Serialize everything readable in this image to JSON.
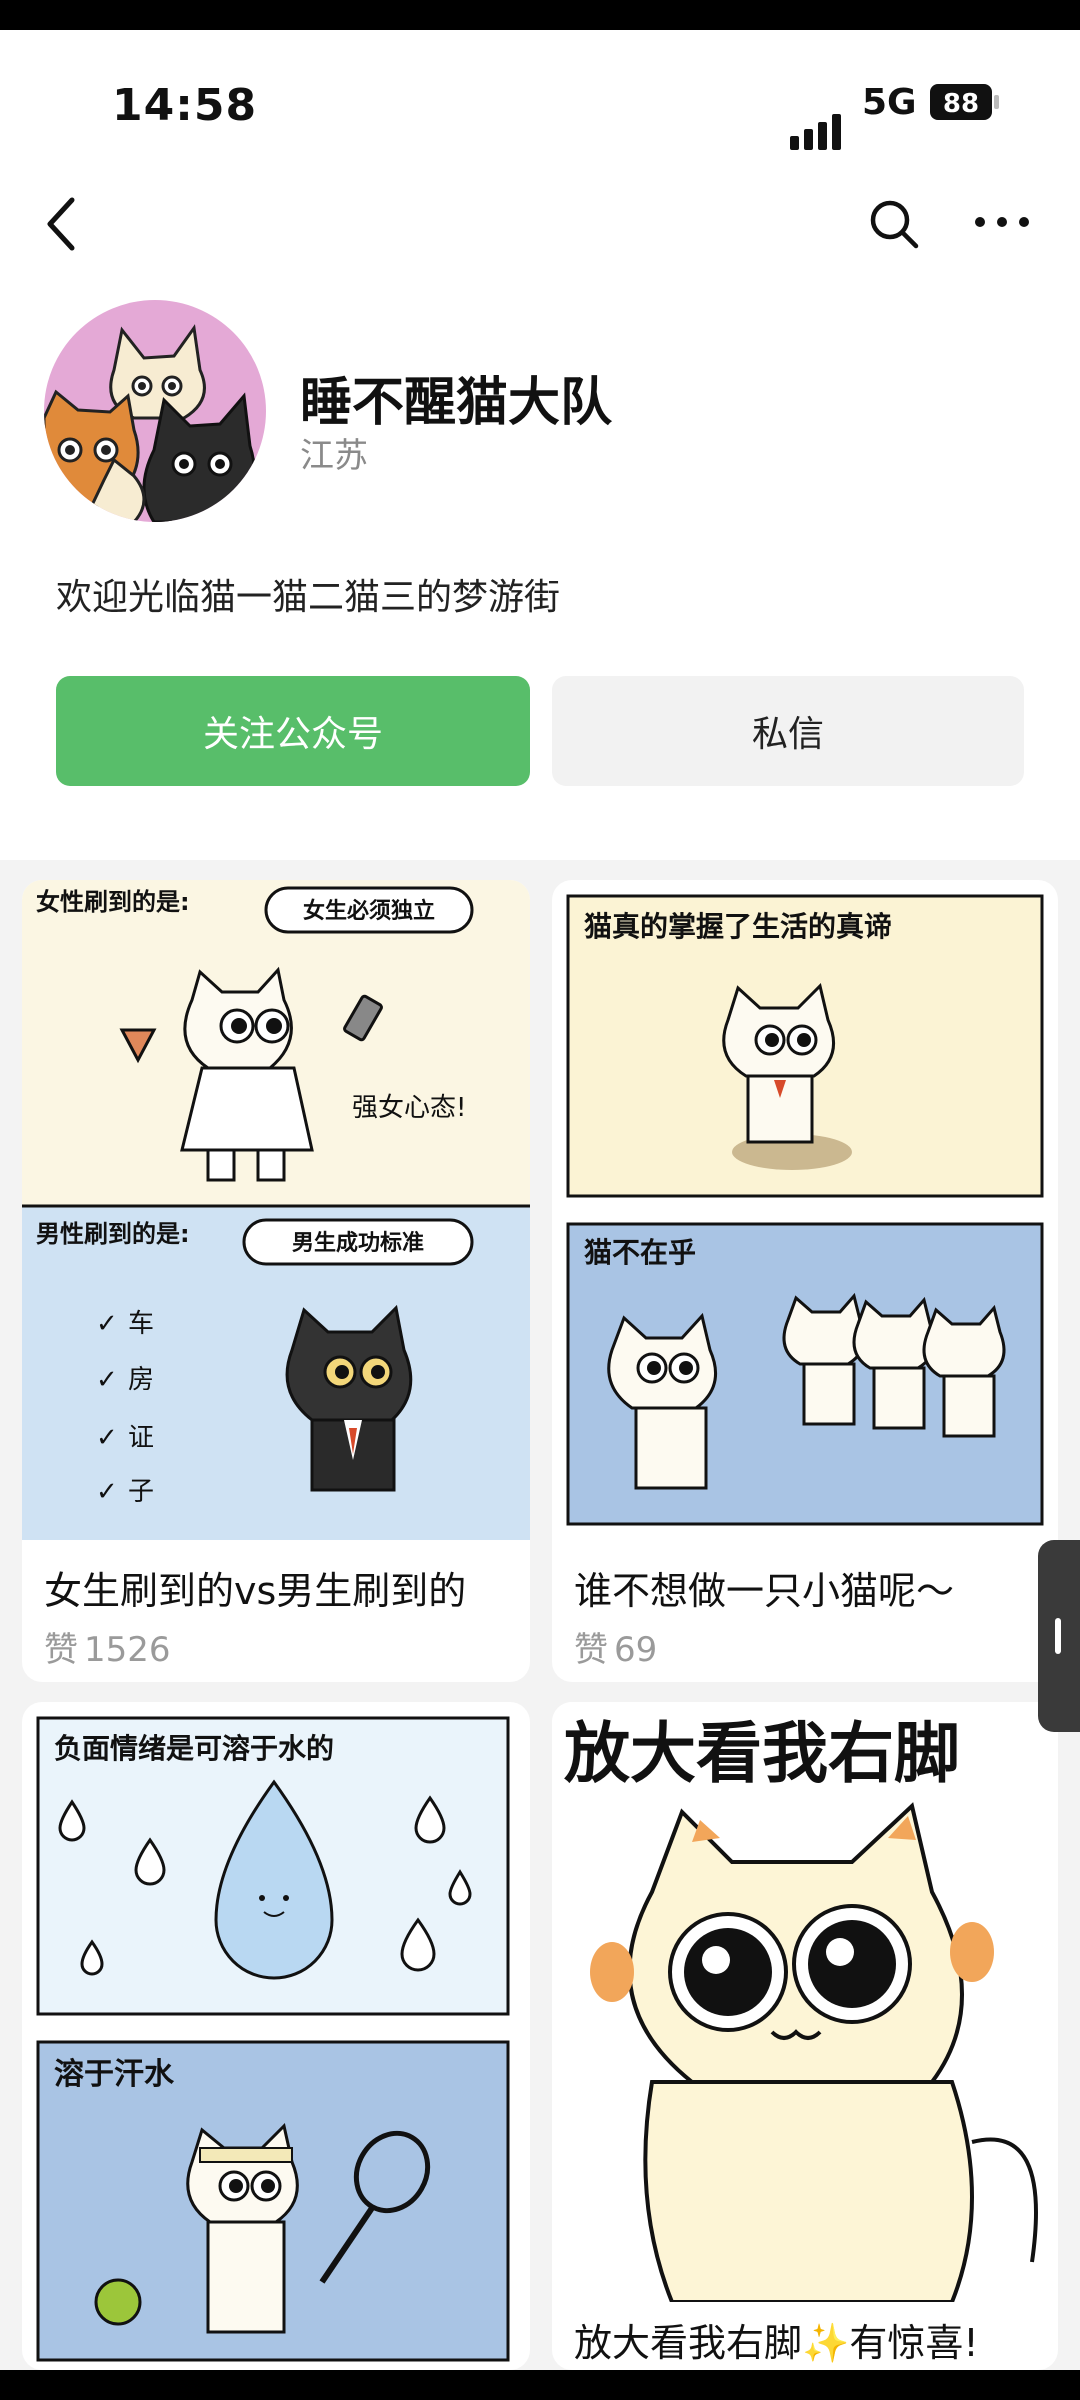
{
  "status": {
    "time": "14:58",
    "network": "5G",
    "battery": "88"
  },
  "nav": {
    "back_icon": "back-arrow-icon",
    "search_icon": "search-icon",
    "more_icon": "more-dots-icon"
  },
  "profile": {
    "name": "睡不醒猫大队",
    "location": "江苏",
    "bio": "欢迎光临猫一猫二猫三的梦游街"
  },
  "actions": {
    "follow_label": "关注公众号",
    "message_label": "私信"
  },
  "cards": [
    {
      "title": "女生刷到的vs男生刷到的",
      "likes_label": "赞",
      "likes": "1526",
      "panels": {
        "top_heading": "女性刷到的是:",
        "top_bubble": "女生必须独立",
        "top_note": "强女心态!",
        "bottom_heading": "男性刷到的是:",
        "bottom_bubble": "男生成功标准",
        "checks": [
          "车",
          "房",
          "证",
          "子"
        ]
      }
    },
    {
      "title": "谁不想做一只小猫呢～",
      "likes_label": "赞",
      "likes": "69",
      "panels": {
        "top_heading": "猫真的掌握了生活的真谛",
        "bottom_heading": "猫不在乎"
      }
    },
    {
      "title": "",
      "panels": {
        "top_heading": "负面情绪是可溶于水的",
        "bottom_heading": "溶于汗水"
      }
    },
    {
      "title": "放大看我右脚✨有惊喜!",
      "panels": {
        "headline": "放大看我右脚"
      }
    }
  ],
  "colors": {
    "accent": "#58be6a",
    "panel_cream": "#fbf6e3",
    "panel_blue": "#cfe2f3",
    "panel_mid_blue": "#a9c4e4"
  }
}
